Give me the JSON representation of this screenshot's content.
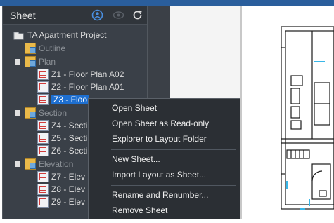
{
  "panel": {
    "title": "Sheet",
    "header_icons": [
      "open-sheet-icon",
      "visibility-eye-icon",
      "refresh-icon"
    ]
  },
  "tree": {
    "project": "TA Apartment Project",
    "outline": "Outline",
    "plan": {
      "label": "Plan",
      "items": [
        "Z1 - Floor Plan A02",
        "Z2 - Floor Plan A01",
        "Z3 - Floo"
      ]
    },
    "section": {
      "label": "Section",
      "items": [
        "Z4 - Secti",
        "Z5 - Secti",
        "Z6 - Secti"
      ]
    },
    "elevation": {
      "label": "Elevation",
      "items": [
        "Z7 - Elev",
        "Z8 - Elev",
        "Z9 - Elev"
      ]
    }
  },
  "context_menu": {
    "items": [
      "Open Sheet",
      "Open Sheet as Read-only",
      "Explorer to Layout Folder",
      "New Sheet...",
      "Import Layout as Sheet...",
      "Rename and Renumber...",
      "Remove Sheet"
    ]
  },
  "colors": {
    "panel_bg": "#3a4048",
    "menu_bg": "#2b2f34",
    "selection": "#1e6fd0",
    "folder": "#e9b94a",
    "sheet_mark": "#d13c3c"
  }
}
